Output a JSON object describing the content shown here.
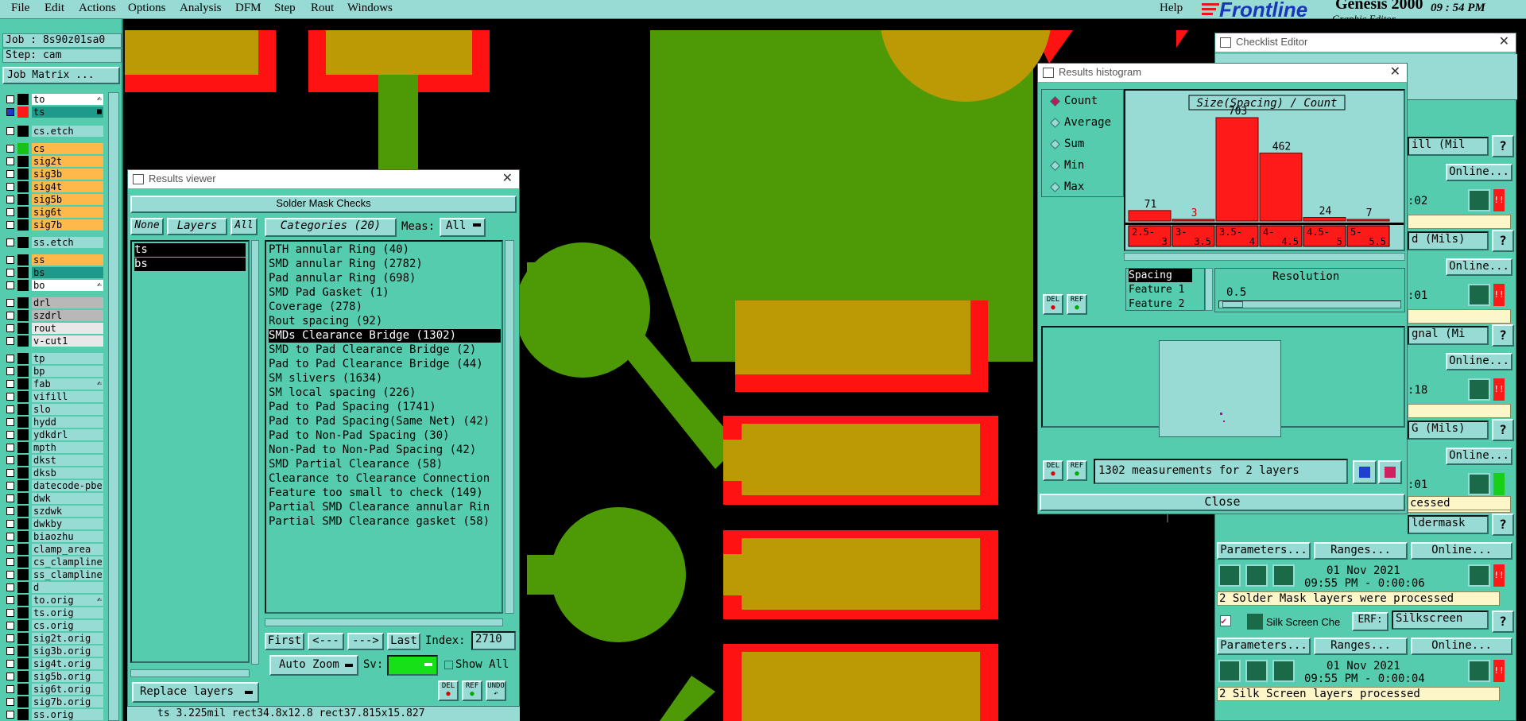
{
  "menu": {
    "items": [
      "File",
      "Edit",
      "Actions",
      "Options",
      "Analysis",
      "DFM",
      "Step",
      "Rout",
      "Windows"
    ],
    "help": "Help",
    "brand": "Frontline",
    "product": "Genesis 2000",
    "product_sub": "Graphic Editor",
    "clock": "09 : 54  PM"
  },
  "job": {
    "job_label": "Job : 8s90z01sa0",
    "step_label": "Step: cam",
    "matrix_button": "Job Matrix ..."
  },
  "layers": [
    {
      "name": "to",
      "color": "#ffffff",
      "tag": "✍"
    },
    {
      "name": "ts",
      "color": "#1f9a8a",
      "tag": "■"
    },
    {
      "name": "cs.etch",
      "color": "#98dad4",
      "tag": ""
    },
    {
      "name": "cs",
      "color": "#ffb84a",
      "tag": ""
    },
    {
      "name": "sig2t",
      "color": "#ffb84a",
      "tag": ""
    },
    {
      "name": "sig3b",
      "color": "#ffb84a",
      "tag": ""
    },
    {
      "name": "sig4t",
      "color": "#ffb84a",
      "tag": ""
    },
    {
      "name": "sig5b",
      "color": "#ffb84a",
      "tag": ""
    },
    {
      "name": "sig6t",
      "color": "#ffb84a",
      "tag": ""
    },
    {
      "name": "sig7b",
      "color": "#ffb84a",
      "tag": ""
    },
    {
      "name": "ss.etch",
      "color": "#98dad4",
      "tag": ""
    },
    {
      "name": "ss",
      "color": "#ffb84a",
      "tag": ""
    },
    {
      "name": "bs",
      "color": "#1f9a8a",
      "tag": ""
    },
    {
      "name": "bo",
      "color": "#ffffff",
      "tag": "✍"
    },
    {
      "name": "drl",
      "color": "#b8b8b8",
      "tag": ""
    },
    {
      "name": "szdrl",
      "color": "#b8b8b8",
      "tag": ""
    },
    {
      "name": "rout",
      "color": "#e8e8e8",
      "tag": ""
    },
    {
      "name": "v-cut1",
      "color": "#e8e8e8",
      "tag": ""
    },
    {
      "name": "tp",
      "color": "#98dad4",
      "tag": ""
    },
    {
      "name": "bp",
      "color": "#98dad4",
      "tag": ""
    },
    {
      "name": "fab",
      "color": "#98dad4",
      "tag": "✍"
    },
    {
      "name": "vifill",
      "color": "#98dad4",
      "tag": ""
    },
    {
      "name": "slo",
      "color": "#98dad4",
      "tag": ""
    },
    {
      "name": "hydd",
      "color": "#98dad4",
      "tag": ""
    },
    {
      "name": "ydkdrl",
      "color": "#98dad4",
      "tag": ""
    },
    {
      "name": "mpth",
      "color": "#98dad4",
      "tag": ""
    },
    {
      "name": "dkst",
      "color": "#98dad4",
      "tag": ""
    },
    {
      "name": "dksb",
      "color": "#98dad4",
      "tag": ""
    },
    {
      "name": "datecode-pbe",
      "color": "#98dad4",
      "tag": ""
    },
    {
      "name": "dwk",
      "color": "#98dad4",
      "tag": ""
    },
    {
      "name": "szdwk",
      "color": "#98dad4",
      "tag": ""
    },
    {
      "name": "dwkby",
      "color": "#98dad4",
      "tag": ""
    },
    {
      "name": "biaozhu",
      "color": "#98dad4",
      "tag": ""
    },
    {
      "name": "clamp_area",
      "color": "#98dad4",
      "tag": ""
    },
    {
      "name": "cs_clampline",
      "color": "#98dad4",
      "tag": ""
    },
    {
      "name": "ss_clampline",
      "color": "#98dad4",
      "tag": ""
    },
    {
      "name": "d",
      "color": "#98dad4",
      "tag": ""
    },
    {
      "name": "to.orig",
      "color": "#98dad4",
      "tag": "✍"
    },
    {
      "name": "ts.orig",
      "color": "#98dad4",
      "tag": ""
    },
    {
      "name": "cs.orig",
      "color": "#98dad4",
      "tag": ""
    },
    {
      "name": "sig2t.orig",
      "color": "#98dad4",
      "tag": ""
    },
    {
      "name": "sig3b.orig",
      "color": "#98dad4",
      "tag": ""
    },
    {
      "name": "sig4t.orig",
      "color": "#98dad4",
      "tag": ""
    },
    {
      "name": "sig5b.orig",
      "color": "#98dad4",
      "tag": ""
    },
    {
      "name": "sig6t.orig",
      "color": "#98dad4",
      "tag": ""
    },
    {
      "name": "sig7b.orig",
      "color": "#98dad4",
      "tag": ""
    },
    {
      "name": "ss.orig",
      "color": "#98dad4",
      "tag": ""
    }
  ],
  "results_viewer": {
    "title": "Results viewer",
    "header": "Solder Mask Checks",
    "none_btn": "None",
    "layers_btn": "Layers",
    "all_btn": "All",
    "layer_list": [
      "ts",
      "bs"
    ],
    "categories_btn": "Categories (20)",
    "meas_label": "Meas:",
    "meas_value": "All",
    "categories": [
      "PTH annular Ring (40)",
      "SMD annular Ring (2782)",
      "Pad annular Ring (698)",
      "SMD Pad Gasket (1)",
      "Coverage (278)",
      "Rout spacing (92)",
      "SMDs Clearance Bridge (1302)",
      "SMD to Pad Clearance Bridge (2)",
      "Pad to Pad Clearance Bridge (44)",
      "SM slivers (1634)",
      "SM local spacing (226)",
      "Pad to Pad Spacing (1741)",
      "Pad to Pad Spacing(Same Net) (42)",
      "Pad to Non-Pad Spacing (30)",
      "Non-Pad to Non-Pad Spacing (42)",
      "SMD Partial Clearance (58)",
      "Clearance to Clearance Connection",
      "Feature too small to check (149)",
      "Partial SMD Clearance annular Rin",
      "Partial SMD Clearance gasket (58)"
    ],
    "selected_index": 6,
    "nav": {
      "first": "First",
      "prev": "<---",
      "next": "--->",
      "last": "Last",
      "index_label": "Index:",
      "index_value": "2710"
    },
    "auto_zoom": "Auto Zoom",
    "sv_label": "Sv:",
    "show_all": "Show All",
    "replace_layers": "Replace layers",
    "del": "DEL",
    "ref": "REF",
    "undo": "UNDO",
    "status": "ts 3.225mil   rect34.8x12.8   rect37.815x15.827"
  },
  "histogram": {
    "title": "Results histogram",
    "radios": [
      "Count",
      "Average",
      "Sum",
      "Min",
      "Max"
    ],
    "selected_radio": 0,
    "chart_title": "Size(Spacing) / Count",
    "bins": [
      {
        "label": "2.5-\n3",
        "count": 71
      },
      {
        "label": "3-\n3.5",
        "count": 3
      },
      {
        "label": "3.5-\n4",
        "count": 703
      },
      {
        "label": "4-\n4.5",
        "count": 462
      },
      {
        "label": "4.5-\n5",
        "count": 24
      },
      {
        "label": "5-\n5.5",
        "count": 7
      }
    ],
    "attrs": [
      "Spacing",
      "Feature 1",
      "Feature 2"
    ],
    "resolution_label": "Resolution",
    "resolution_value": "0.5",
    "measurements": "1302 measurements for 2 layers",
    "close": "Close",
    "del": "DEL",
    "ref": "REF"
  },
  "checklist": {
    "title": "Checklist Editor",
    "headers": [
      "ill (Mil",
      "d (Mils)",
      "gnal (Mi",
      "G (Mils)",
      "ldermask"
    ],
    "online": "Online...",
    "times": [
      ":02",
      ":01",
      ":18",
      ":01"
    ],
    "processed_fragment": "cessed",
    "solder_date": "01 Nov 2021",
    "solder_time": "09:55 PM - 0:00:06",
    "solder_msg": "2 Solder Mask layers were processed",
    "parameters": "Parameters...",
    "ranges": "Ranges...",
    "silk_label": "Silk Screen Che",
    "erf_label": "ERF:",
    "erf_value": "Silkscreen",
    "silk_date": "01 Nov 2021",
    "silk_time": "09:55 PM - 0:00:04",
    "silk_msg": "2 Silk Screen layers processed",
    "close": "Close",
    "q": "?"
  },
  "colors": {
    "panel": "#55ccae",
    "button": "#98dad4",
    "pad_orange": "#bc9a06",
    "mask_red": "#ff1212",
    "copper_green": "#4e9a06",
    "bar_red": "#ff1a1a"
  }
}
